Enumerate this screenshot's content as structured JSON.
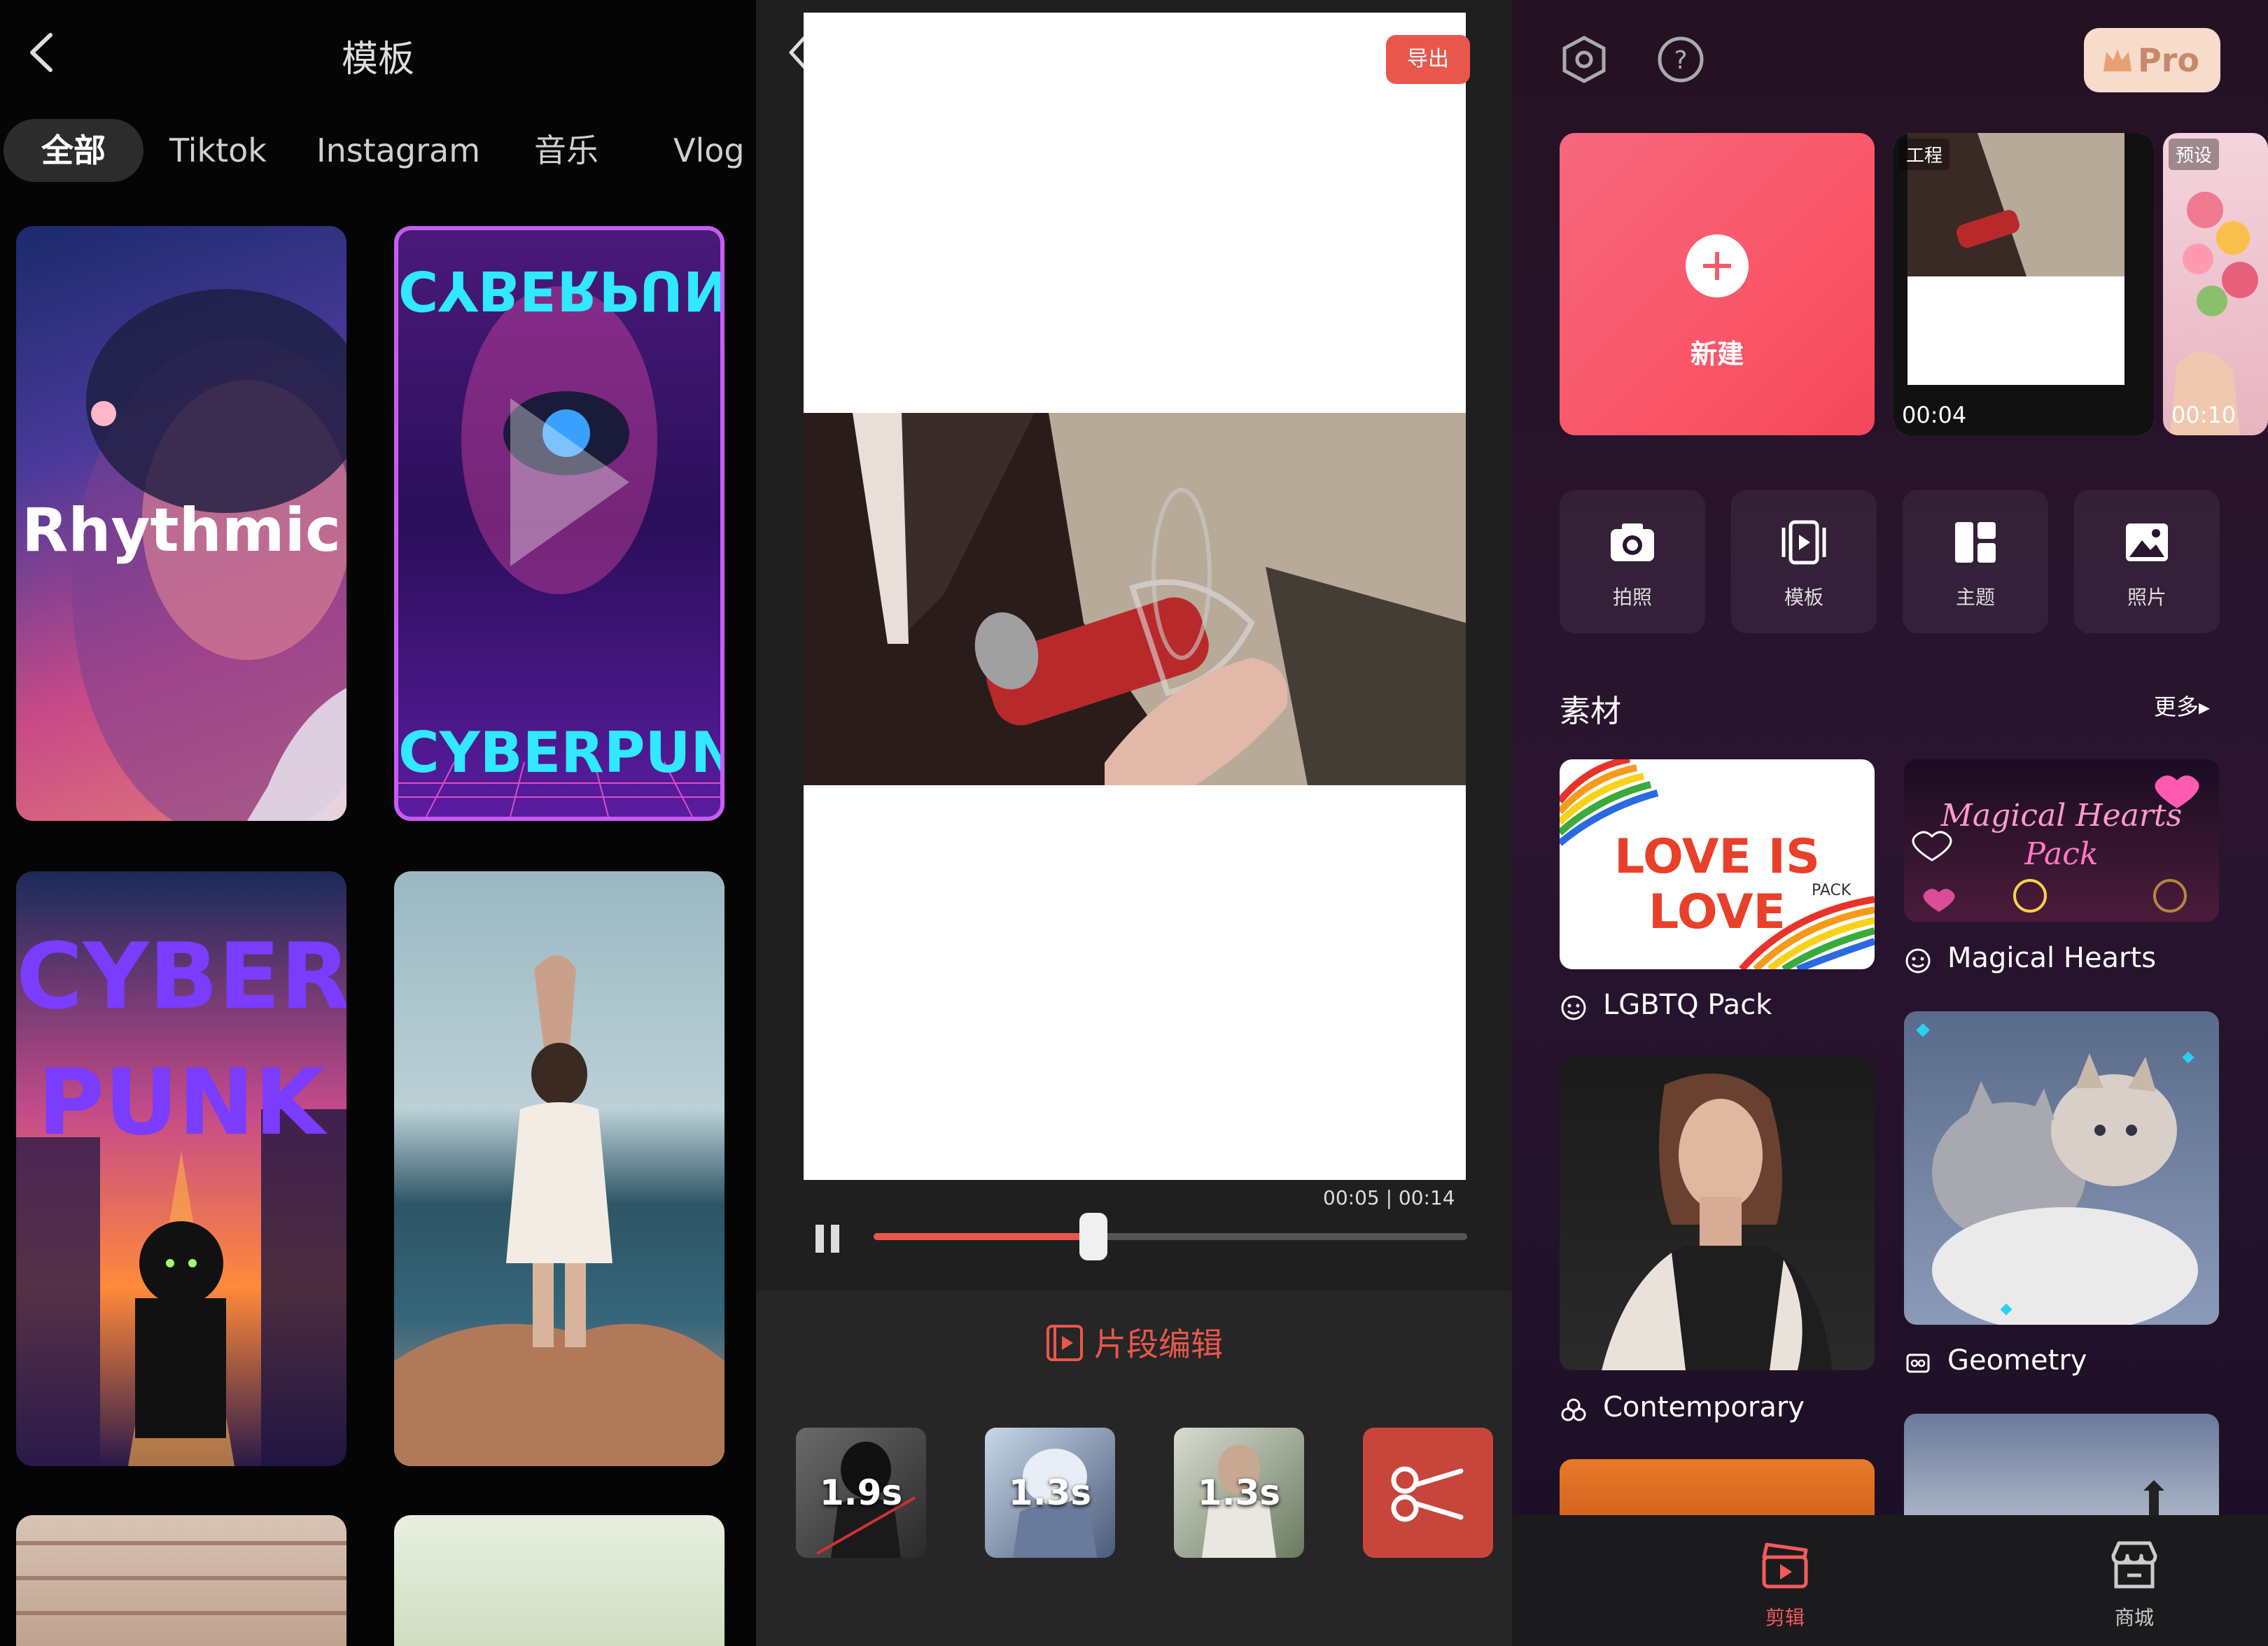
{
  "templates_screen": {
    "title": "模板",
    "tabs": [
      {
        "label": "全部",
        "active": true
      },
      {
        "label": "Tiktok",
        "active": false
      },
      {
        "label": "Instagram",
        "active": false
      },
      {
        "label": "音乐",
        "active": false
      },
      {
        "label": "Vlog",
        "active": false
      }
    ],
    "cards": [
      {
        "label": "Rhythmic"
      },
      {
        "label": "CYBERPUNK",
        "mirrored": "CYBERPUNK"
      },
      {
        "label": "CYBER PUNK",
        "line1": "CYBER",
        "line2": "PUNK"
      },
      {
        "label": ""
      },
      {
        "label": ""
      },
      {
        "label": ""
      }
    ]
  },
  "editor_screen": {
    "export_label": "导出",
    "time": "00:05 | 00:14",
    "progress": 0.37,
    "section_title": "片段编辑",
    "clips": [
      {
        "duration": "1.9s"
      },
      {
        "duration": "1.3s"
      },
      {
        "duration": "1.3s"
      }
    ],
    "accent": "#e9574c"
  },
  "home_screen": {
    "pro_label": "Pro",
    "new_label": "新建",
    "projects": [
      {
        "tag": "工程",
        "duration": "00:04"
      },
      {
        "tag": "预设",
        "duration": "00:10"
      }
    ],
    "quick_actions": [
      {
        "label": "拍照",
        "icon": "camera-icon"
      },
      {
        "label": "模板",
        "icon": "template-icon"
      },
      {
        "label": "主题",
        "icon": "theme-icon"
      },
      {
        "label": "照片",
        "icon": "photo-icon"
      }
    ],
    "materials_title": "素材",
    "more_label": "更多▸",
    "materials": [
      {
        "name": "LGBTQ Pack",
        "banner": "LOVE IS LOVE",
        "sub": "PACK"
      },
      {
        "name": "Magical Hearts",
        "banner": "Magical Hearts",
        "sub": "Pack"
      },
      {
        "name": "Contemporary"
      },
      {
        "name": "Geometry"
      }
    ],
    "nav": [
      {
        "label": "剪辑",
        "active": true
      },
      {
        "label": "商城",
        "active": false
      }
    ],
    "accent": "#f45a5a"
  }
}
